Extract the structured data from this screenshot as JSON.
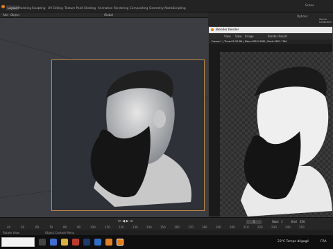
{
  "workspace_tabs": [
    "Layout",
    "Modeling",
    "Sculpting",
    "UV Editing",
    "Texture Paint",
    "Shading",
    "Animation",
    "Rendering",
    "Compositing",
    "Geometry Nodes",
    "Scripting"
  ],
  "header": {
    "add": "Add",
    "object": "Object",
    "transform": "Global",
    "options": "Options"
  },
  "scene": {
    "label": "Scene",
    "outliner": "Scene Collection"
  },
  "render_window": {
    "title": "Blender Render",
    "menu": [
      "View",
      "View",
      "Image"
    ],
    "slot": "Render Result",
    "info": "Frame:1 | Time:01:55.84 | Mem:163.5.28M | Peak:1851.70M"
  },
  "timeline": {
    "ticks": [
      "40",
      "50",
      "60",
      "70",
      "80",
      "90",
      "100",
      "110",
      "120",
      "130",
      "140",
      "150",
      "160",
      "170",
      "180",
      "190",
      "200",
      "210",
      "220",
      "230",
      "240",
      "250"
    ],
    "current_frame": "1",
    "start_label": "Start",
    "start": "1",
    "end_label": "End",
    "end": "250"
  },
  "statusbar": {
    "left": "Rotate View",
    "mid": "Object Context Menu"
  },
  "taskbar": {
    "weather": "23°C  Temps dégagé",
    "lang": "FRA"
  }
}
